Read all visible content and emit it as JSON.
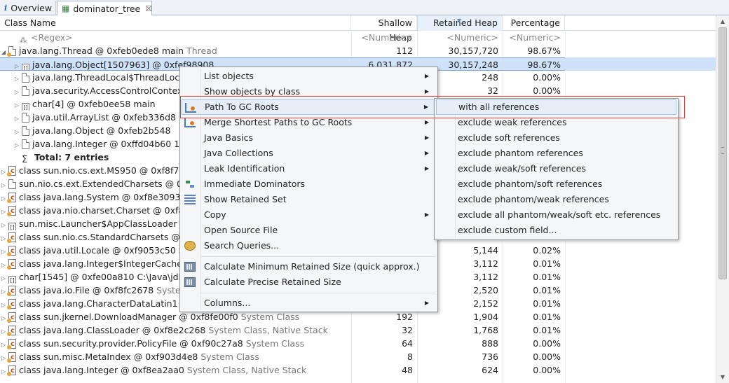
{
  "tabs": [
    {
      "label": "Overview",
      "icon": "info-icon",
      "active": false
    },
    {
      "label": "dominator_tree",
      "icon": "tree-icon",
      "active": true,
      "close": "☒"
    }
  ],
  "columns": [
    "Class Name",
    "Shallow Heap",
    "Retained Heap",
    "Percentage"
  ],
  "filter_row": {
    "name": "<Regex>",
    "shallow": "<Numeric>",
    "retained": "<Numeric>",
    "percentage": "<Numeric>"
  },
  "rows": [
    {
      "name": "java.lang.Thread @ 0xfeb0ede8  main ",
      "suffix": "Thread",
      "shallow": "112",
      "retained": "30,157,720",
      "pct": "98.67%",
      "level": 0,
      "expander": "◢",
      "icon": "file"
    },
    {
      "name": "java.lang.Object[1507963] @ 0xfef98908",
      "suffix": "",
      "shallow": "6,031,872",
      "retained": "30,157,248",
      "pct": "98.67%",
      "level": 1,
      "expander": "▷",
      "icon": "arr",
      "selected": true
    },
    {
      "name": "java.lang.ThreadLocal$ThreadLoca",
      "suffix": "",
      "shallow": "",
      "retained": "248",
      "pct": "0.00%",
      "level": 1,
      "expander": "▷",
      "icon": "file"
    },
    {
      "name": "java.security.AccessControlContext",
      "suffix": "",
      "shallow": "",
      "retained": "32",
      "pct": "0.00%",
      "level": 1,
      "expander": "▷",
      "icon": "file"
    },
    {
      "name": "char[4] @ 0xfeb0ee58  main",
      "suffix": "",
      "shallow": "",
      "retained": "",
      "pct": "",
      "level": 1,
      "expander": "▷",
      "icon": "arr"
    },
    {
      "name": "java.util.ArrayList @ 0xfeb336d8",
      "suffix": "",
      "shallow": "",
      "retained": "",
      "pct": "",
      "level": 1,
      "expander": "▷",
      "icon": "file"
    },
    {
      "name": "java.lang.Object @ 0xfeb2b548",
      "suffix": "",
      "shallow": "",
      "retained": "",
      "pct": "",
      "level": 1,
      "expander": "▷",
      "icon": "file"
    },
    {
      "name": "java.lang.Integer @ 0xffd04b60  15",
      "suffix": "",
      "shallow": "",
      "retained": "",
      "pct": "",
      "level": 1,
      "expander": "▷",
      "icon": "file"
    },
    {
      "name": "Total: 7 entries",
      "suffix": "",
      "shallow": "",
      "retained": "",
      "pct": "",
      "level": 1,
      "expander": "",
      "icon": "sum"
    },
    {
      "name": "class sun.nio.cs.ext.MS950 @ 0xf8f777",
      "suffix": "",
      "shallow": "",
      "retained": "",
      "pct": "",
      "level": 0,
      "expander": "▷",
      "icon": "class"
    },
    {
      "name": "sun.nio.cs.ext.ExtendedCharsets @ 0xf",
      "suffix": "",
      "shallow": "",
      "retained": "",
      "pct": "",
      "level": 0,
      "expander": "▷",
      "icon": "file"
    },
    {
      "name": "class java.lang.System @ 0xf8e30938",
      "suffix": "",
      "shallow": "",
      "retained": "",
      "pct": "",
      "level": 0,
      "expander": "▷",
      "icon": "class"
    },
    {
      "name": "class java.nio.charset.Charset @ 0xf8f0",
      "suffix": "",
      "shallow": "",
      "retained": "",
      "pct": "",
      "level": 0,
      "expander": "▷",
      "icon": "class"
    },
    {
      "name": "sun.misc.Launcher$AppClassLoader @",
      "suffix": "",
      "shallow": "",
      "retained": "",
      "pct": "",
      "level": 0,
      "expander": "▷",
      "icon": "arr"
    },
    {
      "name": "class sun.nio.cs.StandardCharsets @ 0x",
      "suffix": "",
      "shallow": "",
      "retained": "",
      "pct": "",
      "level": 0,
      "expander": "▷",
      "icon": "class"
    },
    {
      "name": "class java.util.Locale @ 0xf9053c50 ",
      "suffix": "Sy",
      "shallow": "",
      "retained": "5,144",
      "pct": "0.02%",
      "level": 0,
      "expander": "▷",
      "icon": "class"
    },
    {
      "name": "class java.lang.Integer$IntegerCache @",
      "suffix": "",
      "shallow": "",
      "retained": "3,112",
      "pct": "0.01%",
      "level": 0,
      "expander": "▷",
      "icon": "class"
    },
    {
      "name": "char[1545] @ 0xfe00a810  C:\\Java\\jdk",
      "suffix": "",
      "shallow": "",
      "retained": "3,112",
      "pct": "0.01%",
      "level": 0,
      "expander": "▷",
      "icon": "arr"
    },
    {
      "name": "class java.io.File @ 0xf8fc2678 ",
      "suffix": "System",
      "shallow": "",
      "retained": "2,520",
      "pct": "0.01%",
      "level": 0,
      "expander": "▷",
      "icon": "class"
    },
    {
      "name": "class java.lang.CharacterDataLatin1 @",
      "suffix": "",
      "shallow": "",
      "retained": "2,152",
      "pct": "0.01%",
      "level": 0,
      "expander": "▷",
      "icon": "class"
    },
    {
      "name": "class sun.jkernel.DownloadManager @ 0xf8fe00f0 ",
      "suffix": "System Class",
      "shallow": "192",
      "retained": "1,904",
      "pct": "0.01%",
      "level": 0,
      "expander": "▷",
      "icon": "class"
    },
    {
      "name": "class java.lang.ClassLoader @ 0xf8e2c268 ",
      "suffix": "System Class, Native Stack",
      "shallow": "32",
      "retained": "1,768",
      "pct": "0.01%",
      "level": 0,
      "expander": "▷",
      "icon": "class"
    },
    {
      "name": "class sun.security.provider.PolicyFile @ 0xf90c27a8 ",
      "suffix": "System Class",
      "shallow": "64",
      "retained": "888",
      "pct": "0.00%",
      "level": 0,
      "expander": "▷",
      "icon": "class"
    },
    {
      "name": "class sun.misc.MetaIndex @ 0xf903d4e8 ",
      "suffix": "System Class",
      "shallow": "8",
      "retained": "736",
      "pct": "0.00%",
      "level": 0,
      "expander": "▷",
      "icon": "class"
    },
    {
      "name": "class java.lang.Integer @ 0xf8ea2aa0 ",
      "suffix": "System Class, Native Stack",
      "shallow": "48",
      "retained": "624",
      "pct": "0.00%",
      "level": 0,
      "expander": "▷",
      "icon": "class"
    }
  ],
  "context_menu": {
    "items": [
      {
        "label": "List objects",
        "submenu": true,
        "icon": ""
      },
      {
        "label": "Show objects by class",
        "submenu": true,
        "icon": ""
      },
      {
        "label": "Path To GC Roots",
        "submenu": true,
        "icon": "path",
        "highlighted": true
      },
      {
        "label": "Merge Shortest Paths to GC Roots",
        "submenu": true,
        "icon": "path"
      },
      {
        "label": "Java Basics",
        "submenu": true,
        "icon": ""
      },
      {
        "label": "Java Collections",
        "submenu": true,
        "icon": ""
      },
      {
        "label": "Leak Identification",
        "submenu": true,
        "icon": ""
      },
      {
        "label": "Immediate Dominators",
        "submenu": false,
        "icon": "dom"
      },
      {
        "label": "Show Retained Set",
        "submenu": false,
        "icon": "ret"
      },
      {
        "label": "Copy",
        "submenu": true,
        "icon": ""
      },
      {
        "label": "Open Source File",
        "submenu": false,
        "icon": ""
      },
      {
        "label": "Search Queries...",
        "submenu": false,
        "icon": "query"
      },
      {
        "label": "Calculate Minimum Retained Size (quick approx.)",
        "submenu": false,
        "icon": "calc"
      },
      {
        "label": "Calculate Precise Retained Size",
        "submenu": false,
        "icon": "calc"
      },
      {
        "label": "Columns...",
        "submenu": true,
        "icon": ""
      }
    ]
  },
  "submenu": {
    "items": [
      "with all references",
      "exclude weak references",
      "exclude soft references",
      "exclude phantom references",
      "exclude weak/soft references",
      "exclude phantom/soft references",
      "exclude phantom/weak references",
      "exclude all phantom/weak/soft etc. references",
      "exclude custom field..."
    ]
  },
  "colors": {
    "selection": "#cfe2fa",
    "annotation": "#e23a3a",
    "menu_bg": "#f5f6f7"
  }
}
